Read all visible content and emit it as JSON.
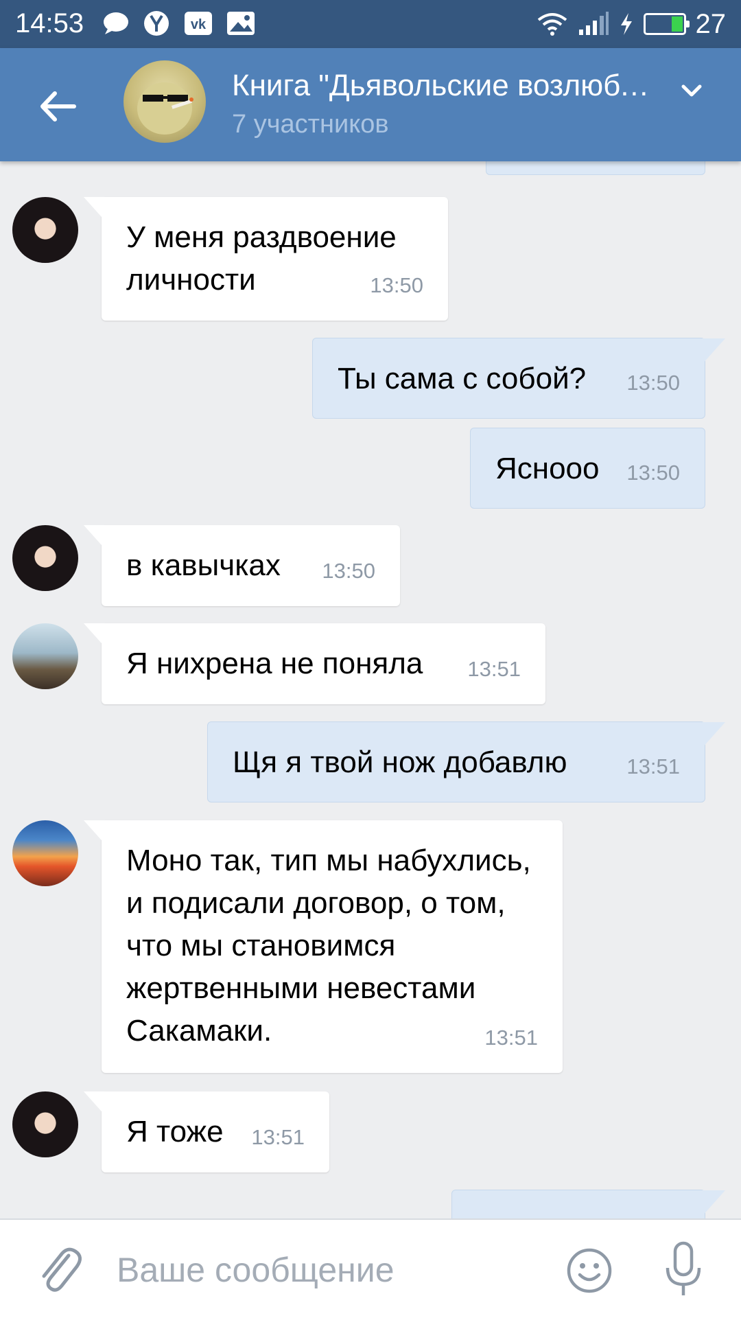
{
  "status_bar": {
    "time": "14:53",
    "battery": "27",
    "battery_level": 0.27,
    "icons": [
      "chat-bubble-icon",
      "yandex-icon",
      "vk-icon",
      "gallery-icon",
      "wifi-icon",
      "signal-icon",
      "charging-icon",
      "battery-icon"
    ]
  },
  "header": {
    "title": "Книга \"Дьявольские возлюбленные\"",
    "subtitle": "7 участников"
  },
  "messages": [
    {
      "dir": "in",
      "avatar": "girl",
      "text": "У меня раздвоение личности",
      "time": "13:50"
    },
    {
      "dir": "out",
      "text": "Ты сама с собой?",
      "time": "13:50"
    },
    {
      "dir": "out",
      "text": "Ясноoo",
      "time": "13:50"
    },
    {
      "dir": "in",
      "avatar": "girl",
      "text": "в кавычках",
      "time": "13:50"
    },
    {
      "dir": "in",
      "avatar": "photo",
      "text": "Я нихрена не поняла",
      "time": "13:51"
    },
    {
      "dir": "out",
      "text": "Щя я твой нож добавлю",
      "time": "13:51"
    },
    {
      "dir": "in",
      "avatar": "sunset",
      "text": "Моно так, тип мы набухлись, и подисали договор, о том, что мы становимся жертвенными невестами Сакамаки.",
      "time": "13:51"
    },
    {
      "dir": "in",
      "avatar": "girl",
      "text": "Я тоже",
      "time": "13:51"
    }
  ],
  "composer": {
    "placeholder": "Ваше сообщение"
  },
  "colors": {
    "header": "#5181b8",
    "status_bar": "#35577f",
    "background": "#edeef0",
    "incoming_bubble": "#ffffff",
    "outgoing_bubble": "#dce8f6"
  }
}
